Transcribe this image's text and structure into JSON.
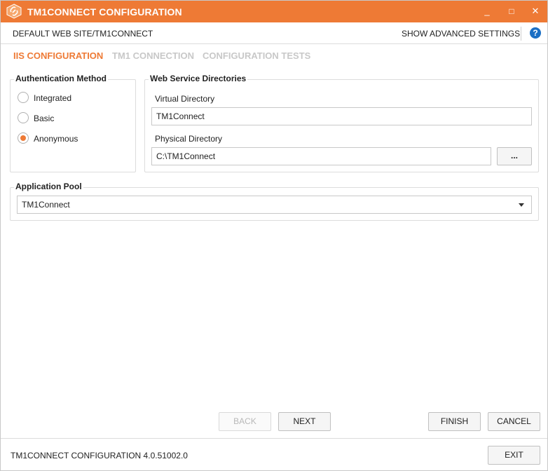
{
  "window": {
    "title": "TM1CONNECT CONFIGURATION",
    "minimize": "_",
    "maximize": "□",
    "close": "✕",
    "accent": "#ee7a35"
  },
  "header": {
    "site": "DEFAULT WEB SITE/TM1CONNECT",
    "advanced": "SHOW ADVANCED SETTINGS",
    "help": "?"
  },
  "tabs": [
    {
      "label": "IIS CONFIGURATION",
      "active": true
    },
    {
      "label": "TM1 CONNECTION",
      "active": false
    },
    {
      "label": "CONFIGURATION TESTS",
      "active": false
    }
  ],
  "auth": {
    "legend": "Authentication Method",
    "options": [
      {
        "label": "Integrated",
        "checked": false
      },
      {
        "label": "Basic",
        "checked": false
      },
      {
        "label": "Anonymous",
        "checked": true
      }
    ]
  },
  "webdirs": {
    "legend": "Web Service Directories",
    "virtual_label": "Virtual Directory",
    "virtual_value": "TM1Connect",
    "physical_label": "Physical Directory",
    "physical_value": "C:\\TM1Connect",
    "browse": "..."
  },
  "pool": {
    "legend": "Application Pool",
    "value": "TM1Connect"
  },
  "nav": {
    "back": "BACK",
    "next": "NEXT",
    "finish": "FINISH",
    "cancel": "CANCEL",
    "exit": "EXIT"
  },
  "footer": {
    "version": "TM1CONNECT CONFIGURATION 4.0.51002.0"
  }
}
